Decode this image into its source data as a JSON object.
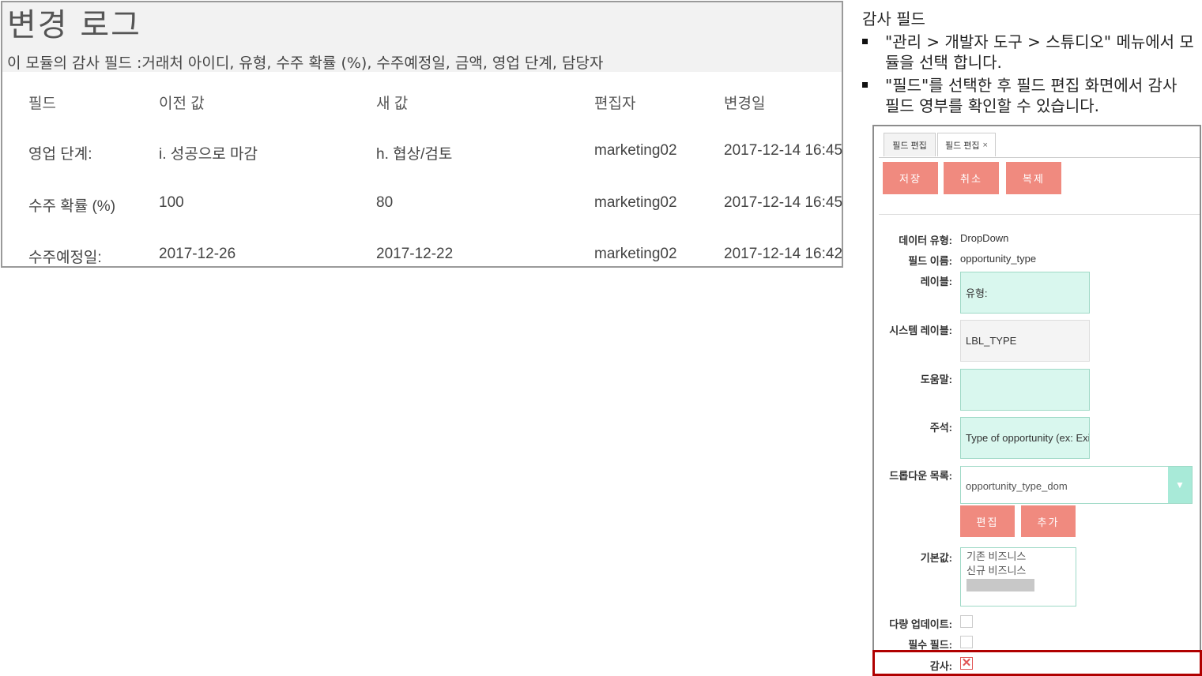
{
  "log": {
    "title": "변경 로그",
    "description": "이 모듈의 감사 필드 :거래처 아이디, 유형, 수주 확률 (%), 수주예정일, 금액, 영업 단계, 담당자",
    "columns": [
      "필드",
      "이전 값",
      "새 값",
      "편집자",
      "변경일"
    ],
    "rows": [
      [
        "영업 단계:",
        "i. 성공으로 마감",
        "h. 협상/검토",
        "marketing02",
        "2017-12-14 16:45"
      ],
      [
        "수주 확률 (%)",
        "100",
        "80",
        "marketing02",
        "2017-12-14 16:45"
      ],
      [
        "수주예정일:",
        "2017-12-26",
        "2017-12-22",
        "marketing02",
        "2017-12-14 16:42"
      ]
    ]
  },
  "note": {
    "title": "감사 필드",
    "items": [
      "\"관리 > 개발자 도구 > 스튜디오\" 메뉴에서 모듈을 선택 합니다.",
      "\"필드\"를 선택한 후 필드 편집 화면에서 감사 필드 영부를 확인할 수 있습니다."
    ]
  },
  "editor": {
    "tabs": [
      "필드 편집",
      "필드 편집"
    ],
    "tab_close": "×",
    "buttons": {
      "save": "저장",
      "cancel": "취소",
      "duplicate": "복제"
    },
    "fields": {
      "data_type_label": "데이터 유형:",
      "data_type_value": "DropDown",
      "field_name_label": "필드 이름:",
      "field_name_value": "opportunity_type",
      "label_label": "레이블:",
      "label_value": "유형:",
      "system_label_label": "시스템 레이블:",
      "system_label_value": "LBL_TYPE",
      "help_label": "도움말:",
      "help_value": "",
      "comment_label": "주석:",
      "comment_value": "Type of opportunity (ex: Existing, New)",
      "dropdown_list_label": "드롭다운 목록:",
      "dropdown_list_value": "opportunity_type_dom",
      "edit_button": "편집",
      "add_button": "추가",
      "default_label": "기본값:",
      "default_options": [
        "기존 비즈니스",
        "신규 비즈니스"
      ],
      "mass_update_label": "다량 업데이트:",
      "mass_update_checked": false,
      "required_label": "필수 필드:",
      "required_checked": false,
      "audit_label": "감사:",
      "audit_checked": true,
      "audit_mark": "✕"
    },
    "colors": {
      "button": "#f08a7f",
      "input_bg": "#d9f7ee",
      "highlight_border": "#b00000"
    }
  }
}
